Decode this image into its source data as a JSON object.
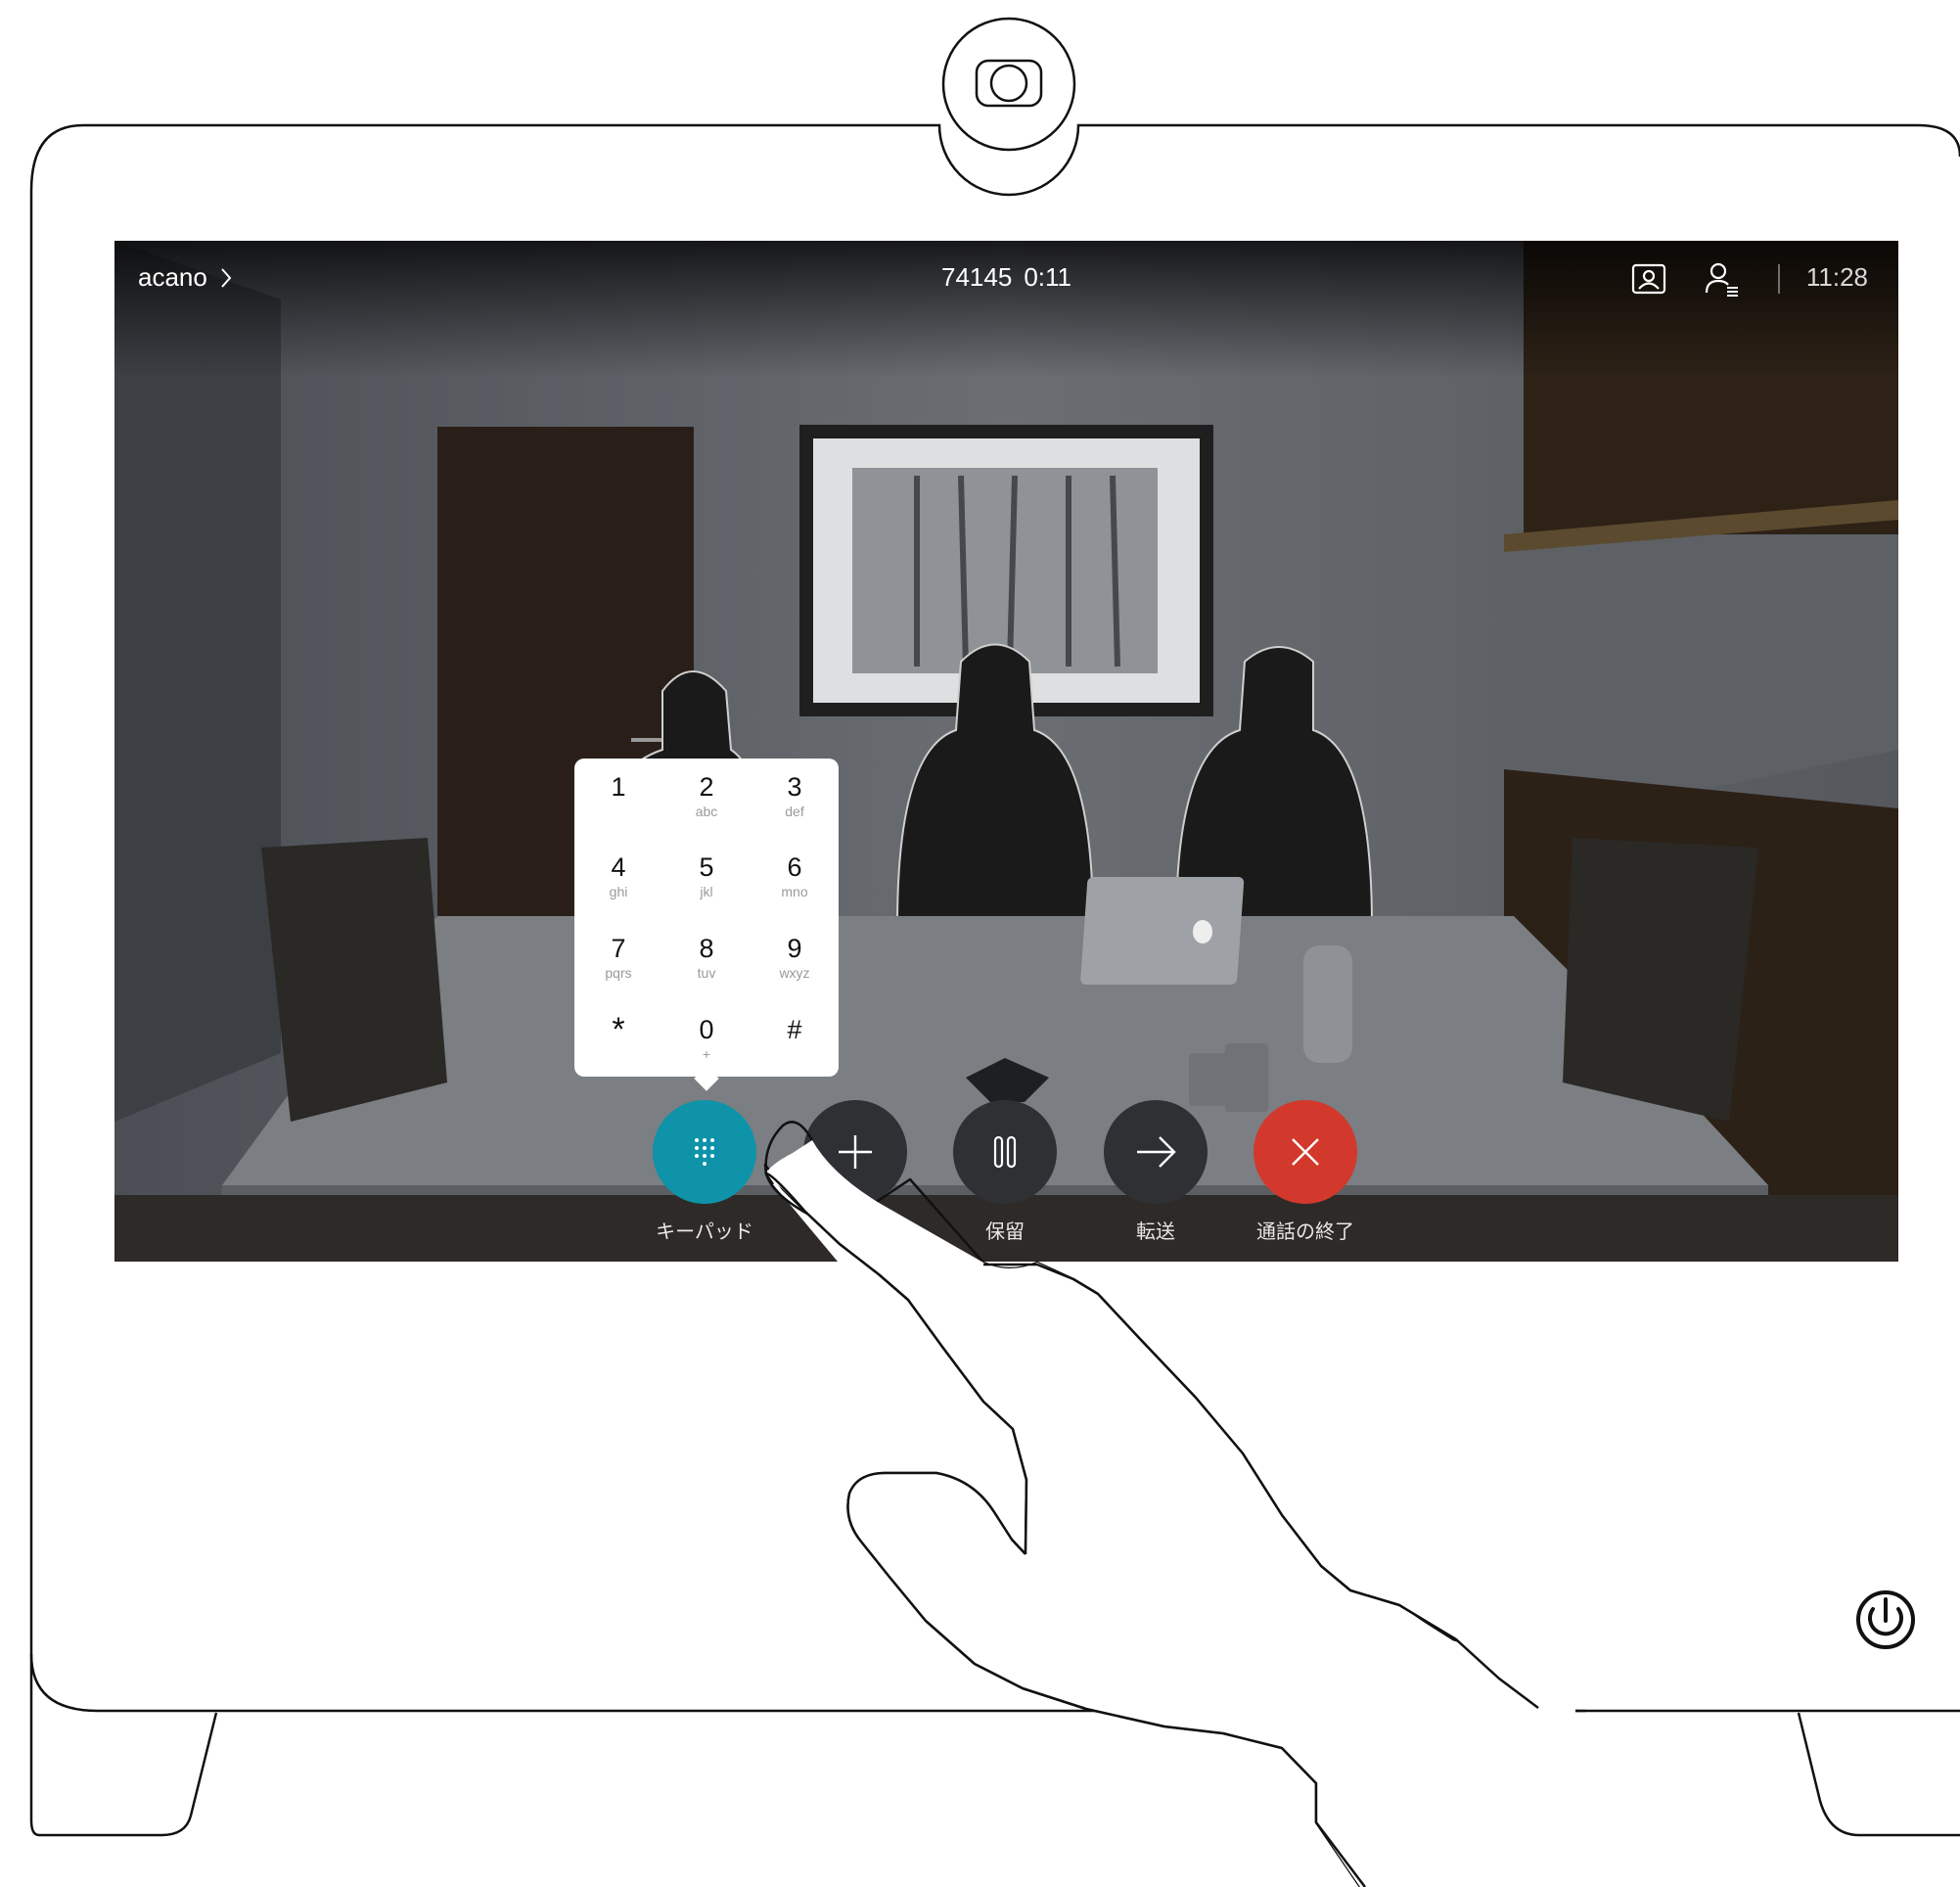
{
  "topbar": {
    "breadcrumb": "acano",
    "call_number": "74145",
    "call_duration": "0:11",
    "clock": "11:28",
    "icons": [
      "selfview-icon",
      "participants-icon",
      "chevron-right-icon"
    ]
  },
  "keypad": {
    "keys": [
      {
        "digit": "1",
        "letters": ""
      },
      {
        "digit": "2",
        "letters": "abc"
      },
      {
        "digit": "3",
        "letters": "def"
      },
      {
        "digit": "4",
        "letters": "ghi"
      },
      {
        "digit": "5",
        "letters": "jkl"
      },
      {
        "digit": "6",
        "letters": "mno"
      },
      {
        "digit": "7",
        "letters": "pqrs"
      },
      {
        "digit": "8",
        "letters": "tuv"
      },
      {
        "digit": "9",
        "letters": "wxyz"
      },
      {
        "digit": "*",
        "letters": ""
      },
      {
        "digit": "0",
        "letters": "+"
      },
      {
        "digit": "#",
        "letters": ""
      }
    ]
  },
  "call_controls": {
    "keypad_label": "キーパッド",
    "hold_label": "保留",
    "transfer_label": "転送",
    "end_label": "通話の終了",
    "icons": [
      "keypad-icon",
      "add-icon",
      "pause-icon",
      "arrow-right-icon",
      "close-icon"
    ]
  },
  "colors": {
    "keypad_button": "#0e93a9",
    "end_call_button": "#d2392c",
    "control_button": "#2e3034"
  },
  "device": {
    "icons": [
      "camera-icon",
      "power-icon"
    ]
  }
}
